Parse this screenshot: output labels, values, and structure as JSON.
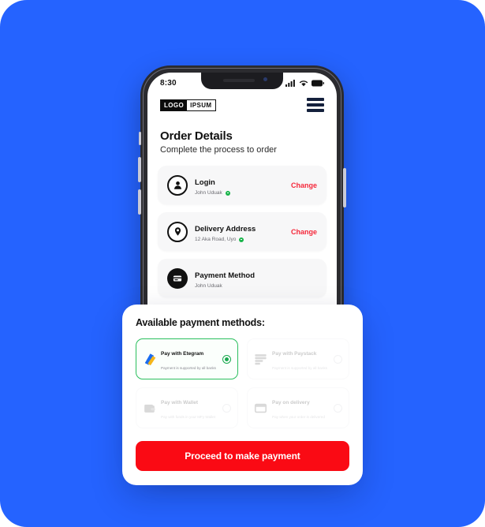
{
  "theme": {
    "background_blue": "#2563FF",
    "accent_red": "#FA0A14",
    "change_red": "#F5283A",
    "selected_green": "#2BBF5E",
    "card_grey": "#F7F7F8"
  },
  "phone": {
    "status_bar": {
      "time": "8:30",
      "icons": [
        "cellular-signal-icon",
        "wifi-icon",
        "battery-icon"
      ]
    },
    "header": {
      "logo_part1": "LOGO",
      "logo_part2": "IPSUM",
      "menu_icon": "hamburger-menu-icon"
    },
    "page": {
      "title": "Order Details",
      "subtitle": "Complete the process to order"
    },
    "order_items": [
      {
        "icon": "user-icon",
        "title": "Login",
        "value": "John Uduak",
        "verified": true,
        "action_label": "Change"
      },
      {
        "icon": "location-pin-icon",
        "title": "Delivery Address",
        "value": "12 Aka Road, Uyo",
        "verified": true,
        "action_label": "Change"
      },
      {
        "icon": "credit-card-icon",
        "title": "Payment Method",
        "value": "John Uduak",
        "verified": false,
        "action_label": ""
      }
    ]
  },
  "sheet": {
    "title": "Available payment methods:",
    "payment_methods": [
      {
        "id": "etegram",
        "icon": "etegram-logo-icon",
        "name": "Pay with Etegram",
        "description": "Payment is supported by all banks",
        "selected": true,
        "disabled": false
      },
      {
        "id": "paystack",
        "icon": "paystack-logo-icon",
        "name": "Pay with Paystack",
        "description": "Payment is supported by all banks",
        "selected": false,
        "disabled": true
      },
      {
        "id": "wallet",
        "icon": "wallet-icon",
        "name": "Pay with Wallet",
        "description": "Pay with funds in your MFy Wallet",
        "selected": false,
        "disabled": true
      },
      {
        "id": "delivery",
        "icon": "package-box-icon",
        "name": "Pay on delivery",
        "description": "Pay when your order is delivered",
        "selected": false,
        "disabled": true
      }
    ],
    "proceed_label": "Proceed to make payment"
  }
}
